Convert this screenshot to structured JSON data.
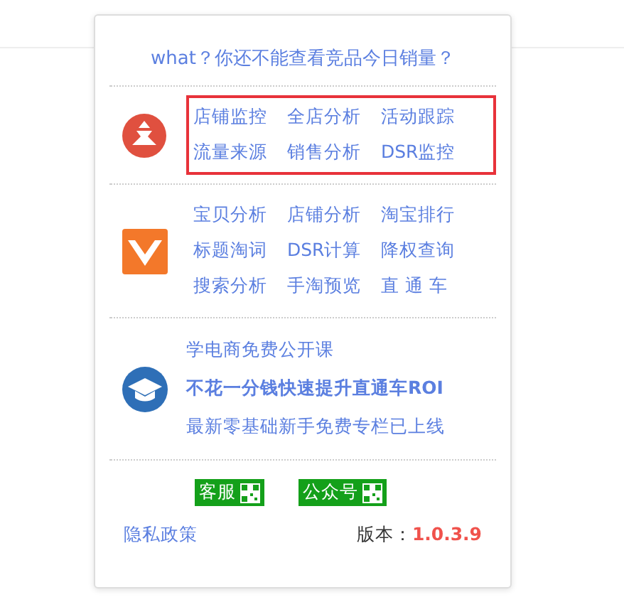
{
  "header": {
    "text": "what？你还不能查看竞品今日销量？"
  },
  "sections": [
    {
      "kind": "links",
      "highlighted": true,
      "links": [
        "店铺监控",
        "全店分析",
        "活动跟踪",
        "流量来源",
        "销售分析",
        "DSR监控"
      ]
    },
    {
      "kind": "links",
      "highlighted": false,
      "links": [
        "宝贝分析",
        "店铺分析",
        "淘宝排行",
        "标题淘词",
        "DSR计算",
        "降权查询",
        "搜索分析",
        "手淘预览",
        "直 通 车"
      ]
    },
    {
      "kind": "course",
      "lines": [
        {
          "text": "学电商免费公开课",
          "bold": false
        },
        {
          "text": "不花一分钱快速提升直通车ROI",
          "bold": true
        },
        {
          "text": "最新零基础新手免费专栏已上线",
          "bold": false
        }
      ]
    }
  ],
  "qr_buttons": [
    "客服",
    "公众号"
  ],
  "footer": {
    "privacy": "隐私政策",
    "version_label": "版本：",
    "version": "1.0.3.9"
  }
}
